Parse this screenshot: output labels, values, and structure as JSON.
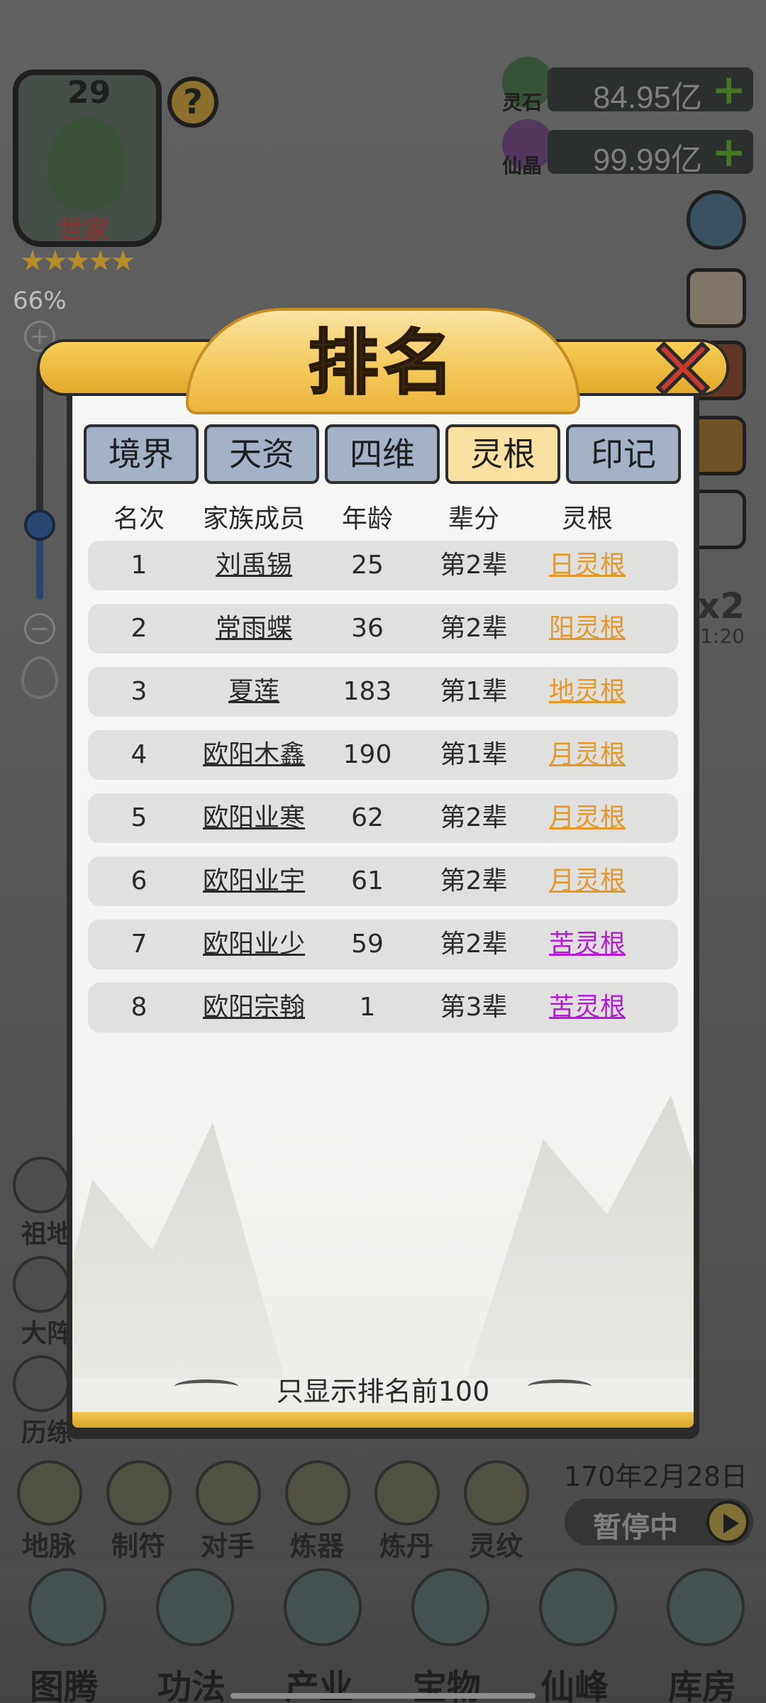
{
  "hud": {
    "family_level": "29",
    "family_title": "世家",
    "stars": "★★★★★",
    "help_icon_glyph": "?",
    "zoom_percent": "66%",
    "resources": [
      {
        "label": "灵石",
        "value": "84.95亿",
        "plus": "+"
      },
      {
        "label": "仙晶",
        "value": "99.99亿",
        "plus": "+"
      }
    ],
    "speed_multiplier": "x2",
    "speed_timer": "1:20"
  },
  "left_functions": [
    "祖地",
    "大阵",
    "历练"
  ],
  "action_bar": [
    "地脉",
    "制符",
    "对手",
    "炼器",
    "炼丹",
    "灵纹"
  ],
  "game_date": "170年2月28日",
  "pause_label": "暂停中",
  "bottom_nav": [
    "图腾",
    "功法",
    "产业",
    "宝物",
    "仙峰",
    "库房"
  ],
  "modal": {
    "title": "排名",
    "close_glyph": "✕",
    "tabs": [
      {
        "label": "境界",
        "active": false
      },
      {
        "label": "天资",
        "active": false
      },
      {
        "label": "四维",
        "active": false
      },
      {
        "label": "灵根",
        "active": true
      },
      {
        "label": "印记",
        "active": false
      }
    ],
    "columns": [
      "名次",
      "家族成员",
      "年龄",
      "辈分",
      "灵根"
    ],
    "rows": [
      {
        "rank": "1",
        "name": "刘禹锡",
        "age": "25",
        "generation": "第2辈",
        "root": "日灵根",
        "root_color": "#e49a2a"
      },
      {
        "rank": "2",
        "name": "常雨蝶",
        "age": "36",
        "generation": "第2辈",
        "root": "阳灵根",
        "root_color": "#e49a2a"
      },
      {
        "rank": "3",
        "name": "夏莲",
        "age": "183",
        "generation": "第1辈",
        "root": "地灵根",
        "root_color": "#e49a2a"
      },
      {
        "rank": "4",
        "name": "欧阳木鑫",
        "age": "190",
        "generation": "第1辈",
        "root": "月灵根",
        "root_color": "#e49a2a"
      },
      {
        "rank": "5",
        "name": "欧阳业寒",
        "age": "62",
        "generation": "第2辈",
        "root": "月灵根",
        "root_color": "#e49a2a"
      },
      {
        "rank": "6",
        "name": "欧阳业宇",
        "age": "61",
        "generation": "第2辈",
        "root": "月灵根",
        "root_color": "#e49a2a"
      },
      {
        "rank": "7",
        "name": "欧阳业少",
        "age": "59",
        "generation": "第2辈",
        "root": "苦灵根",
        "root_color": "#b51bd6"
      },
      {
        "rank": "8",
        "name": "欧阳宗翰",
        "age": "1",
        "generation": "第3辈",
        "root": "苦灵根",
        "root_color": "#b51bd6"
      }
    ],
    "footer": "只显示排名前100"
  }
}
